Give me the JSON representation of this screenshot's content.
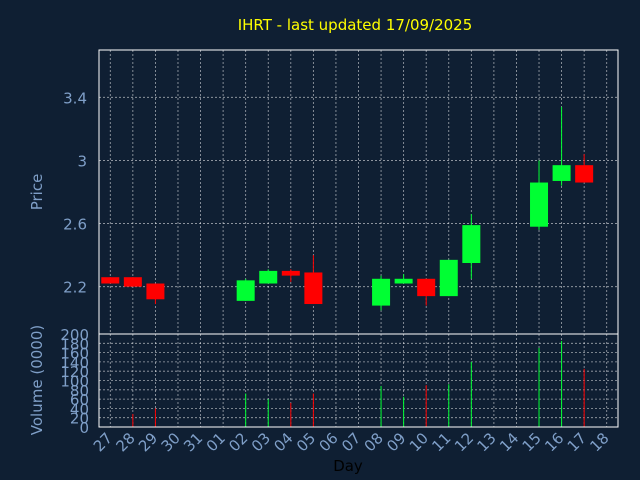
{
  "chart_data": [
    {
      "type": "candlestick",
      "title": "IHRT - last updated 17/09/2025",
      "ylabel": "Price",
      "ylim": [
        1.9,
        3.7
      ],
      "yticks": [
        "2.2",
        "2.6",
        "3",
        "3.4"
      ],
      "ytick_values": [
        2.2,
        2.6,
        3.0,
        3.4
      ],
      "grid": true,
      "categories": [
        "27",
        "28",
        "29",
        "30",
        "31",
        "01",
        "02",
        "03",
        "04",
        "05",
        "06",
        "07",
        "08",
        "09",
        "10",
        "11",
        "12",
        "13",
        "14",
        "15",
        "16",
        "17",
        "18"
      ],
      "candles": [
        {
          "day": "27",
          "open": 2.26,
          "close": 2.22,
          "high": 2.26,
          "low": 2.22
        },
        {
          "day": "28",
          "open": 2.26,
          "close": 2.2,
          "high": 2.26,
          "low": 2.2
        },
        {
          "day": "29",
          "open": 2.22,
          "close": 2.12,
          "high": 2.22,
          "low": 2.09
        },
        {
          "day": "02",
          "open": 2.11,
          "close": 2.24,
          "high": 2.25,
          "low": 2.11
        },
        {
          "day": "03",
          "open": 2.22,
          "close": 2.3,
          "high": 2.31,
          "low": 2.22
        },
        {
          "day": "04",
          "open": 2.3,
          "close": 2.27,
          "high": 2.31,
          "low": 2.23
        },
        {
          "day": "05",
          "open": 2.29,
          "close": 2.09,
          "high": 2.4,
          "low": 2.09
        },
        {
          "day": "08",
          "open": 2.08,
          "close": 2.25,
          "high": 2.27,
          "low": 2.05
        },
        {
          "day": "09",
          "open": 2.22,
          "close": 2.25,
          "high": 2.28,
          "low": 2.22
        },
        {
          "day": "10",
          "open": 2.25,
          "close": 2.14,
          "high": 2.25,
          "low": 2.08
        },
        {
          "day": "11",
          "open": 2.14,
          "close": 2.37,
          "high": 2.37,
          "low": 2.14
        },
        {
          "day": "12",
          "open": 2.35,
          "close": 2.59,
          "high": 2.66,
          "low": 2.25
        },
        {
          "day": "15",
          "open": 2.58,
          "close": 2.86,
          "high": 3.0,
          "low": 2.56
        },
        {
          "day": "16",
          "open": 2.87,
          "close": 2.97,
          "high": 3.34,
          "low": 2.84
        },
        {
          "day": "17",
          "open": 2.97,
          "close": 2.86,
          "high": 3.04,
          "low": 2.86
        }
      ],
      "up_color": "#00ff33",
      "down_color": "#ff0000"
    },
    {
      "type": "bar",
      "xlabel": "Day",
      "ylabel": "Volume (0000)",
      "ylim": [
        0,
        200
      ],
      "yticks": [
        "0",
        "20",
        "40",
        "60",
        "80",
        "100",
        "120",
        "140",
        "160",
        "180",
        "200"
      ],
      "ytick_values": [
        0,
        20,
        40,
        60,
        80,
        100,
        120,
        140,
        160,
        180,
        200
      ],
      "grid": true,
      "categories": [
        "27",
        "28",
        "29",
        "30",
        "31",
        "01",
        "02",
        "03",
        "04",
        "05",
        "06",
        "07",
        "08",
        "09",
        "10",
        "11",
        "12",
        "13",
        "14",
        "15",
        "16",
        "17",
        "18"
      ],
      "values": [
        {
          "day": "28",
          "value": 28,
          "direction": "down"
        },
        {
          "day": "29",
          "value": 40,
          "direction": "down"
        },
        {
          "day": "02",
          "value": 72,
          "direction": "up"
        },
        {
          "day": "03",
          "value": 60,
          "direction": "up"
        },
        {
          "day": "04",
          "value": 52,
          "direction": "down"
        },
        {
          "day": "05",
          "value": 72,
          "direction": "down"
        },
        {
          "day": "08",
          "value": 88,
          "direction": "up"
        },
        {
          "day": "09",
          "value": 65,
          "direction": "up"
        },
        {
          "day": "10",
          "value": 90,
          "direction": "down"
        },
        {
          "day": "11",
          "value": 92,
          "direction": "up"
        },
        {
          "day": "12",
          "value": 140,
          "direction": "up"
        },
        {
          "day": "15",
          "value": 170,
          "direction": "up"
        },
        {
          "day": "16",
          "value": 185,
          "direction": "up"
        },
        {
          "day": "17",
          "value": 125,
          "direction": "down"
        }
      ],
      "up_color": "#00ff33",
      "down_color": "#ff0000"
    }
  ],
  "colors": {
    "background": "#0f1f33",
    "axis_text": "#7f9fc8",
    "title": "#ffff00",
    "xlabel": "#000000",
    "frame": "#ffffff",
    "grid": "#ffffff"
  }
}
